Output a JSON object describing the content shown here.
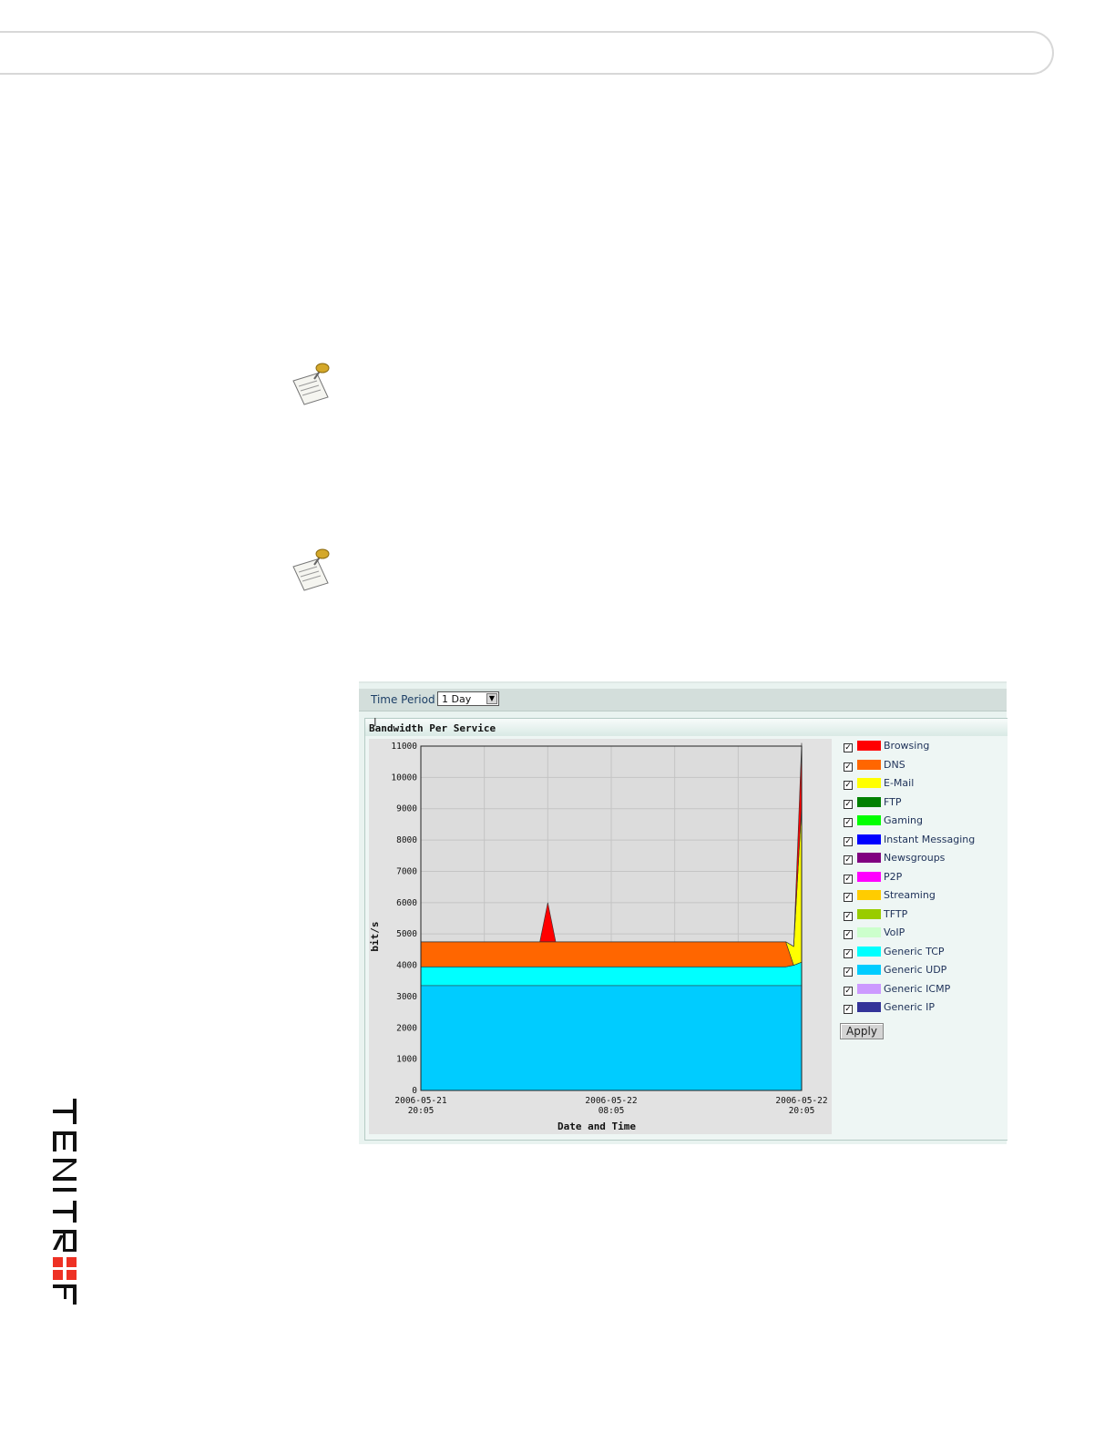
{
  "panel": {
    "time_period_label": "Time Period",
    "time_period_value": "1 Day",
    "section_title": "Bandwidth Per Service",
    "apply_label": "Apply"
  },
  "chart_data": {
    "type": "area",
    "stacked": true,
    "xlabel": "Date and Time",
    "ylabel": "bit/s",
    "ylim": [
      0,
      11000
    ],
    "y_ticks": [
      0,
      1000,
      2000,
      3000,
      4000,
      5000,
      6000,
      7000,
      8000,
      9000,
      10000,
      11000
    ],
    "x_ticks": [
      {
        "date": "2006-05-21",
        "time": "20:05"
      },
      {
        "date": "2006-05-22",
        "time": "08:05"
      },
      {
        "date": "2006-05-22",
        "time": "20:05"
      }
    ],
    "grid": true,
    "x_hours": [
      0,
      2,
      4,
      6,
      7.5,
      8,
      8.5,
      10,
      12,
      14,
      16,
      18,
      20,
      22,
      23,
      23.5,
      24
    ],
    "series": [
      {
        "name": "Generic UDP",
        "color": "#00ccff",
        "values": [
          3350,
          3350,
          3350,
          3350,
          3350,
          3350,
          3350,
          3350,
          3350,
          3350,
          3350,
          3350,
          3350,
          3350,
          3350,
          3350,
          3350
        ]
      },
      {
        "name": "Generic TCP",
        "color": "#00ffff",
        "values": [
          600,
          600,
          600,
          600,
          600,
          600,
          600,
          600,
          600,
          600,
          600,
          600,
          600,
          600,
          600,
          650,
          750
        ]
      },
      {
        "name": "DNS",
        "color": "#ff6600",
        "values": [
          800,
          800,
          800,
          800,
          800,
          800,
          800,
          800,
          800,
          800,
          800,
          800,
          800,
          800,
          800,
          0,
          0
        ]
      },
      {
        "name": "E-Mail",
        "color": "#ffff00",
        "values": [
          0,
          0,
          0,
          0,
          0,
          0,
          0,
          0,
          0,
          0,
          0,
          0,
          0,
          0,
          0,
          600,
          5000
        ]
      },
      {
        "name": "Browsing",
        "color": "#ff0000",
        "values": [
          0,
          0,
          0,
          0,
          0,
          1250,
          0,
          0,
          0,
          0,
          0,
          0,
          0,
          0,
          0,
          0,
          2000
        ]
      }
    ]
  },
  "legend": [
    {
      "label": "Browsing",
      "color": "#ff0000",
      "checked": "✓"
    },
    {
      "label": "DNS",
      "color": "#ff6600",
      "checked": "✓"
    },
    {
      "label": "E-Mail",
      "color": "#ffff00",
      "checked": "✓"
    },
    {
      "label": "FTP",
      "color": "#008000",
      "checked": "✓"
    },
    {
      "label": "Gaming",
      "color": "#00ff00",
      "checked": "✓"
    },
    {
      "label": "Instant Messaging",
      "color": "#0000ff",
      "checked": "✓"
    },
    {
      "label": "Newsgroups",
      "color": "#800080",
      "checked": "✓"
    },
    {
      "label": "P2P",
      "color": "#ff00ff",
      "checked": "✓"
    },
    {
      "label": "Streaming",
      "color": "#ffcc00",
      "checked": "✓"
    },
    {
      "label": "TFTP",
      "color": "#99cc00",
      "checked": "✓"
    },
    {
      "label": "VoIP",
      "color": "#ccffcc",
      "checked": "✓"
    },
    {
      "label": "Generic TCP",
      "color": "#00ffff",
      "checked": "✓"
    },
    {
      "label": "Generic UDP",
      "color": "#00ccff",
      "checked": "✓"
    },
    {
      "label": "Generic ICMP",
      "color": "#cc99ff",
      "checked": "✓"
    },
    {
      "label": "Generic IP",
      "color": "#333399",
      "checked": "✓"
    }
  ],
  "brand": {
    "logo_text": "FORTINET",
    "accent": "#ee3124"
  }
}
